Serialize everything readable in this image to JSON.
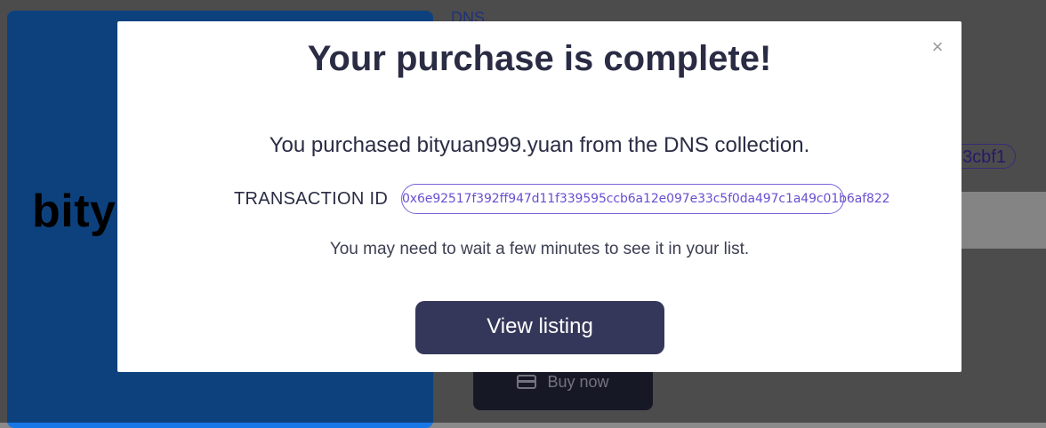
{
  "background": {
    "card_title": "bity",
    "collection_link": "DNS",
    "owner_pill": "3cbf1",
    "buy_button_label": "Buy now",
    "buy_icon": "credit-card-icon"
  },
  "modal": {
    "close_label": "×",
    "title": "Your purchase is complete!",
    "purchase_text": "You purchased bityuan999.yuan from the DNS collection.",
    "transaction_label": "TRANSACTION ID",
    "transaction_id": "0x6e92517f392ff947d11f339595ccb6a12e097e33c5f0da497c1a49c01b6af822",
    "wait_text": "You may need to wait a few minutes to see it in your list.",
    "view_button_label": "View listing"
  },
  "colors": {
    "accent": "#35375a",
    "link": "#6a4fd0",
    "card_bg": "#1877e6"
  }
}
